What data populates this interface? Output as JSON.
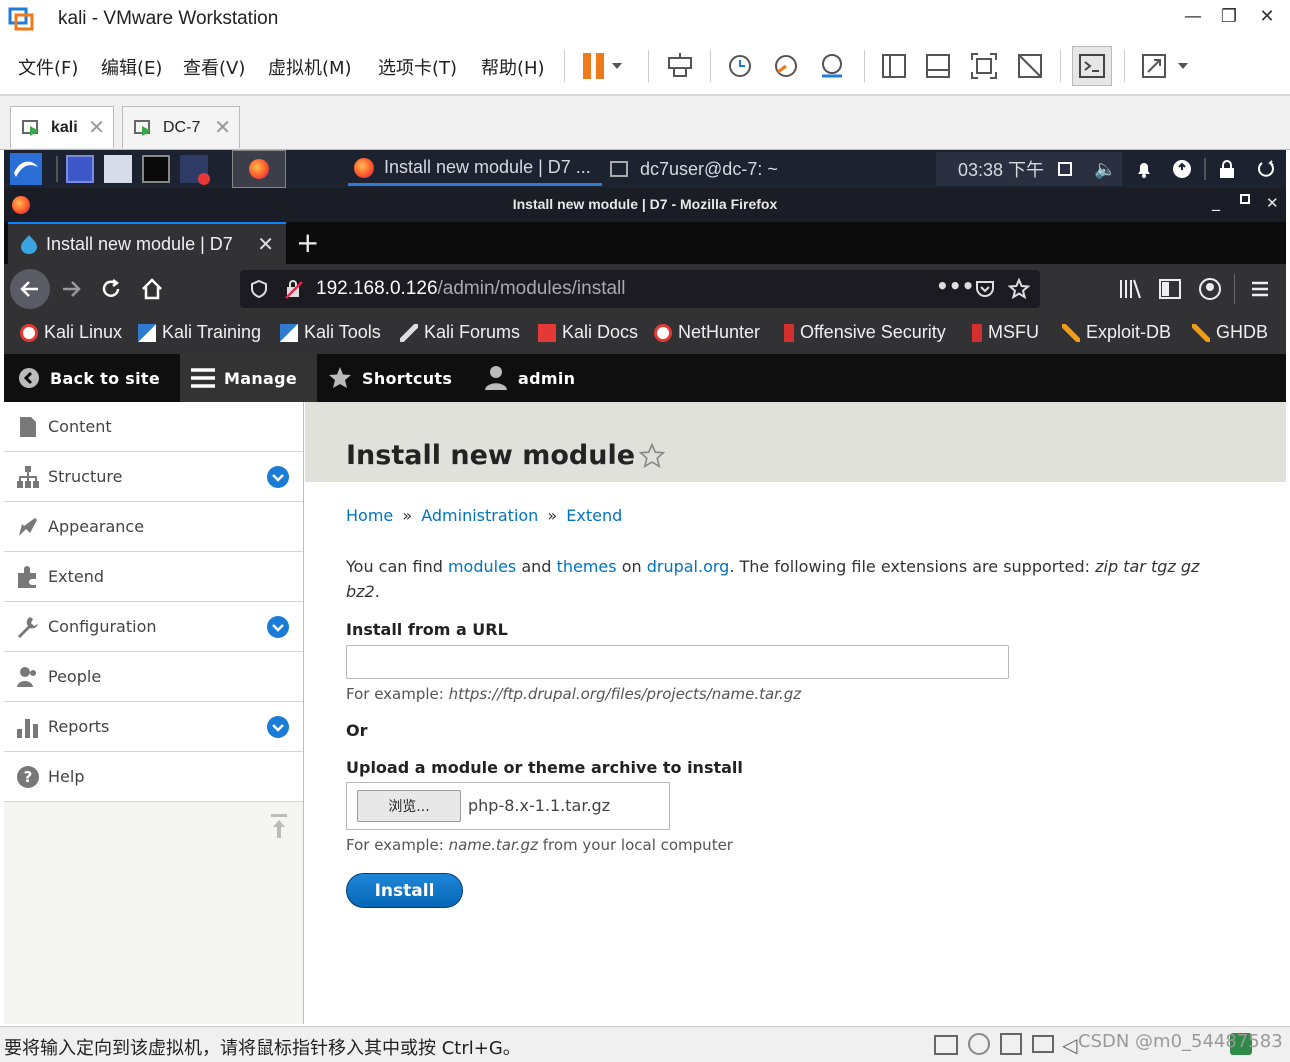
{
  "vmware": {
    "title": "kali - VMware Workstation",
    "menu": [
      "文件(F)",
      "编辑(E)",
      "查看(V)",
      "虚拟机(M)",
      "选项卡(T)",
      "帮助(H)"
    ],
    "tabs": [
      {
        "label": "kali"
      },
      {
        "label": "DC-7"
      }
    ],
    "status_text": "要将输入定向到该虚拟机，请将鼠标指针移入其中或按 Ctrl+G。",
    "watermark": "CSDN @m0_54487583",
    "colors": {
      "pause": "#f07a1a",
      "accent": "#1f7bd8"
    }
  },
  "kali_panel": {
    "task_firefox": "Install new module | D7 ...",
    "task_terminal": "dc7user@dc-7: ~",
    "clock": "03:38 下午"
  },
  "firefox": {
    "window_title": "Install new module | D7 - Mozilla Firefox",
    "tab_title": "Install new module | D7",
    "url_host": "192.168.0.126",
    "url_path": "/admin/modules/install",
    "bookmarks": [
      "Kali Linux",
      "Kali Training",
      "Kali Tools",
      "Kali Forums",
      "Kali Docs",
      "NetHunter",
      "Offensive Security",
      "MSFU",
      "Exploit-DB",
      "GHDB"
    ]
  },
  "drupal": {
    "toolbar": {
      "back": "Back to site",
      "manage": "Manage",
      "shortcuts": "Shortcuts",
      "user": "admin"
    },
    "sidebar": [
      {
        "label": "Content",
        "icon": "content-icon",
        "expandable": false
      },
      {
        "label": "Structure",
        "icon": "structure-icon",
        "expandable": true
      },
      {
        "label": "Appearance",
        "icon": "appearance-icon",
        "expandable": false
      },
      {
        "label": "Extend",
        "icon": "extend-icon",
        "expandable": false
      },
      {
        "label": "Configuration",
        "icon": "configuration-icon",
        "expandable": true
      },
      {
        "label": "People",
        "icon": "people-icon",
        "expandable": false
      },
      {
        "label": "Reports",
        "icon": "reports-icon",
        "expandable": true
      },
      {
        "label": "Help",
        "icon": "help-icon",
        "expandable": false
      }
    ],
    "page_title": "Install new module",
    "breadcrumb": [
      "Home",
      "Administration",
      "Extend"
    ],
    "breadcrumb_sep": "»",
    "intro": {
      "p1": "You can find",
      "link_modules": "modules",
      "and": "and",
      "link_themes": "themes",
      "on": "on",
      "link_drupal": "drupal.org",
      "p2": ". The following file extensions are supported:",
      "extensions": "zip tar tgz gz bz2",
      "end": "."
    },
    "url_field": {
      "label": "Install from a URL",
      "value": "",
      "desc_prefix": "For example:",
      "desc_example": "https://ftp.drupal.org/files/projects/name.tar.gz"
    },
    "or_label": "Or",
    "upload_field": {
      "label": "Upload a module or theme archive to install",
      "browse_label": "浏览...",
      "file_name": "php-8.x-1.1.tar.gz",
      "desc_prefix": "For example:",
      "desc_example": "name.tar.gz",
      "desc_suffix": "from your local computer"
    },
    "install_button": "Install"
  }
}
